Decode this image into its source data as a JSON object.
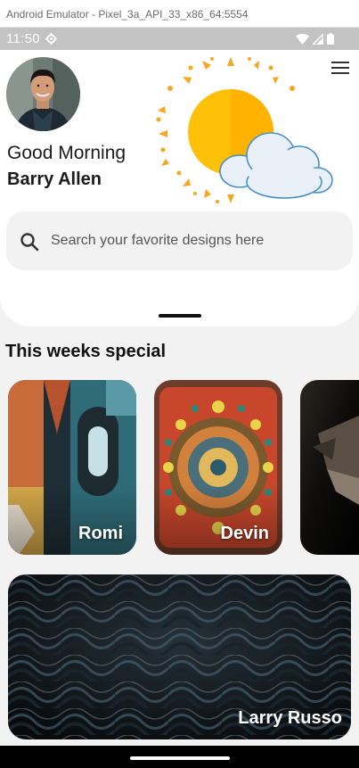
{
  "window": {
    "title": "Android Emulator - Pixel_3a_API_33_x86_64:5554"
  },
  "status_bar": {
    "time": "11:50"
  },
  "header": {
    "greeting": "Good Morning",
    "user_name": "Barry Allen",
    "menu_icon": "hamburger-menu-icon",
    "weather_icon": "partly-sunny-icon"
  },
  "search": {
    "placeholder": "Search your favorite designs here",
    "icon": "search-icon"
  },
  "section": {
    "title": "This weeks special"
  },
  "cards": [
    {
      "label": "Romi"
    },
    {
      "label": "Devin"
    },
    {
      "label": ""
    }
  ],
  "featured": {
    "label": "Larry Russo"
  },
  "colors": {
    "sun": "#FFC107",
    "sun_ray": "#F5A623",
    "cloud_stroke": "#4A90C8",
    "background": "#F2F2F2"
  }
}
